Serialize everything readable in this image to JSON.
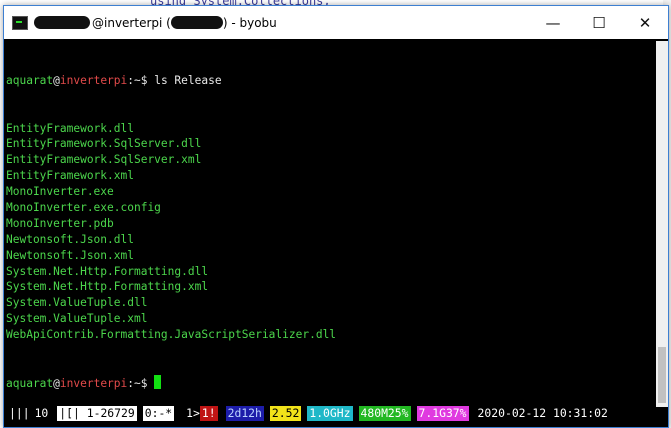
{
  "background": {
    "code_fragment": "using System.Collections;"
  },
  "window": {
    "title_prefix": "@inverterpi (",
    "title_suffix": ") - byobu",
    "controls": {
      "minimize": "—",
      "maximize": "☐",
      "close": "✕"
    }
  },
  "terminal": {
    "prompt_user": "aquarat",
    "prompt_at": "@",
    "prompt_host": "inverterpi",
    "prompt_path": ":~$ ",
    "command": "ls Release",
    "files": [
      "EntityFramework.dll",
      "EntityFramework.SqlServer.dll",
      "EntityFramework.SqlServer.xml",
      "EntityFramework.xml",
      "MonoInverter.exe",
      "MonoInverter.exe.config",
      "MonoInverter.pdb",
      "Newtonsoft.Json.dll",
      "Newtonsoft.Json.xml",
      "System.Net.Http.Formatting.dll",
      "System.Net.Http.Formatting.xml",
      "System.ValueTuple.dll",
      "System.ValueTuple.xml",
      "WebApiContrib.Formatting.JavaScriptSerializer.dll"
    ],
    "final_prompt_path": ":~$ "
  },
  "statusbar": {
    "bars": "|||",
    "release": "10",
    "window_list": "|[| 1-26729",
    "current_window": "0:-*",
    "next_window": "1>",
    "updates": "1!",
    "uptime": "2d12h",
    "load": "2.52",
    "cpu_freq": "1.0GHz",
    "memory": "480M25%",
    "disk": "7.1G37%",
    "datetime": "2020-02-12 10:31:02"
  }
}
